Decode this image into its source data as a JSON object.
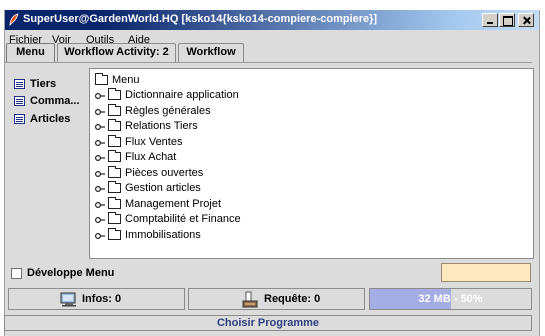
{
  "window": {
    "title": "SuperUser@GardenWorld.HQ [ksko14{ksko14-compiere-compiere}]"
  },
  "menubar": {
    "items": [
      {
        "label": "Fichier"
      },
      {
        "label": "Voir"
      },
      {
        "label": "Outils"
      },
      {
        "label": "Aide"
      }
    ]
  },
  "tabs": [
    {
      "label": "Menu",
      "active": true
    },
    {
      "label": "Workflow Activity: 2",
      "active": false
    },
    {
      "label": "Workflow",
      "active": false
    }
  ],
  "sidebar": {
    "items": [
      {
        "label": "Tiers",
        "icon": "window-icon"
      },
      {
        "label": "Comma...",
        "icon": "window-icon"
      },
      {
        "label": "Articles",
        "icon": "window-icon"
      }
    ]
  },
  "tree": {
    "root": "Menu",
    "nodes": [
      {
        "label": "Dictionnaire application"
      },
      {
        "label": "Règles générales"
      },
      {
        "label": "Relations Tiers"
      },
      {
        "label": "Flux Ventes"
      },
      {
        "label": "Flux Achat"
      },
      {
        "label": "Pièces ouvertes"
      },
      {
        "label": "Gestion articles"
      },
      {
        "label": "Management Projet"
      },
      {
        "label": "Comptabilité et Finance"
      },
      {
        "label": "Immobilisations"
      }
    ]
  },
  "expand": {
    "label": "Développe Menu",
    "checked": false
  },
  "status": {
    "infos_label": "Infos: 0",
    "requests_label": "Requête: 0",
    "memory_label": "32 MB - 50%",
    "memory_fraction": 0.5
  },
  "bottom": {
    "label": "Choisir Programme"
  },
  "colors": {
    "title_bar_start": "#08246b",
    "memory_fill": "#a4aee4",
    "expand_box": "#fde8c0"
  }
}
